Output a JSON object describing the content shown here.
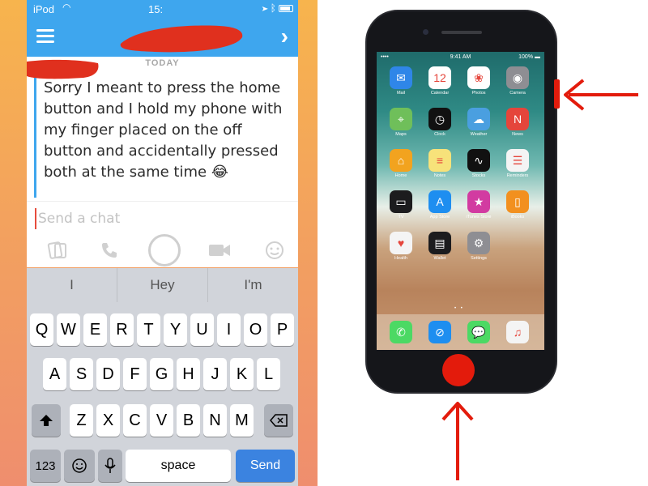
{
  "status_bar": {
    "carrier": "iPod",
    "time": "15:"
  },
  "chat": {
    "date_label": "TODAY",
    "message": "Sorry I meant to press the home button and I hold my phone with my finger placed on the off button and accidentally pressed both at the same time 😂"
  },
  "composer": {
    "placeholder": "Send a chat"
  },
  "keyboard": {
    "suggestions": [
      "I",
      "Hey",
      "I'm"
    ],
    "row1": [
      "Q",
      "W",
      "E",
      "R",
      "T",
      "Y",
      "U",
      "I",
      "O",
      "P"
    ],
    "row2": [
      "A",
      "S",
      "D",
      "F",
      "G",
      "H",
      "J",
      "K",
      "L"
    ],
    "row3": [
      "Z",
      "X",
      "C",
      "V",
      "B",
      "N",
      "M"
    ],
    "numbers_key": "123",
    "space_key": "space",
    "send_key": "Send"
  },
  "phone": {
    "status_left": "•••• ",
    "status_time": "9:41 AM",
    "status_battery": "100% ▬",
    "apps": [
      {
        "label": "Mail",
        "icon": "mail-icon",
        "color": "#2f86e8",
        "glyph": "✉"
      },
      {
        "label": "Calendar",
        "icon": "calendar-icon",
        "color": "#ffffff",
        "glyph": "12"
      },
      {
        "label": "Photos",
        "icon": "photos-icon",
        "color": "#ffffff",
        "glyph": "❀"
      },
      {
        "label": "Camera",
        "icon": "camera-icon",
        "color": "#8e8e93",
        "glyph": "◉"
      },
      {
        "label": "Maps",
        "icon": "maps-icon",
        "color": "#6fbf5a",
        "glyph": "⌖"
      },
      {
        "label": "Clock",
        "icon": "clock-icon",
        "color": "#111111",
        "glyph": "◷"
      },
      {
        "label": "Weather",
        "icon": "weather-icon",
        "color": "#4a9fe0",
        "glyph": "☁"
      },
      {
        "label": "News",
        "icon": "news-icon",
        "color": "#e5453b",
        "glyph": "N"
      },
      {
        "label": "Home",
        "icon": "home-icon",
        "color": "#f2a31f",
        "glyph": "⌂"
      },
      {
        "label": "Notes",
        "icon": "notes-icon",
        "color": "#f7e27a",
        "glyph": "≡"
      },
      {
        "label": "Stocks",
        "icon": "stocks-icon",
        "color": "#111111",
        "glyph": "∿"
      },
      {
        "label": "Reminders",
        "icon": "reminders-icon",
        "color": "#f4f4f4",
        "glyph": "☰"
      },
      {
        "label": "TV",
        "icon": "tv-icon",
        "color": "#1c1c1e",
        "glyph": "▭"
      },
      {
        "label": "App Store",
        "icon": "app-store-icon",
        "color": "#1e8ef0",
        "glyph": "A"
      },
      {
        "label": "iTunes Store",
        "icon": "itunes-store-icon",
        "color": "#d23ba1",
        "glyph": "★"
      },
      {
        "label": "iBooks",
        "icon": "ibooks-icon",
        "color": "#f2901f",
        "glyph": "▯"
      },
      {
        "label": "Health",
        "icon": "health-icon",
        "color": "#f4f4f4",
        "glyph": "♥"
      },
      {
        "label": "Wallet",
        "icon": "wallet-icon",
        "color": "#1c1c1e",
        "glyph": "▤"
      },
      {
        "label": "Settings",
        "icon": "settings-icon",
        "color": "#8e8e93",
        "glyph": "⚙"
      }
    ],
    "dock": [
      {
        "icon": "phone-icon",
        "color": "#4cd964",
        "glyph": "✆"
      },
      {
        "icon": "safari-icon",
        "color": "#1e8ef0",
        "glyph": "⊘"
      },
      {
        "icon": "messages-icon",
        "color": "#4cd964",
        "glyph": "💬"
      },
      {
        "icon": "music-icon",
        "color": "#f4f4f4",
        "glyph": "♫"
      }
    ]
  },
  "colors": {
    "snapchat_blue": "#3ea6ee",
    "highlight_red": "#e31b0c",
    "send_blue": "#3b83e0"
  }
}
